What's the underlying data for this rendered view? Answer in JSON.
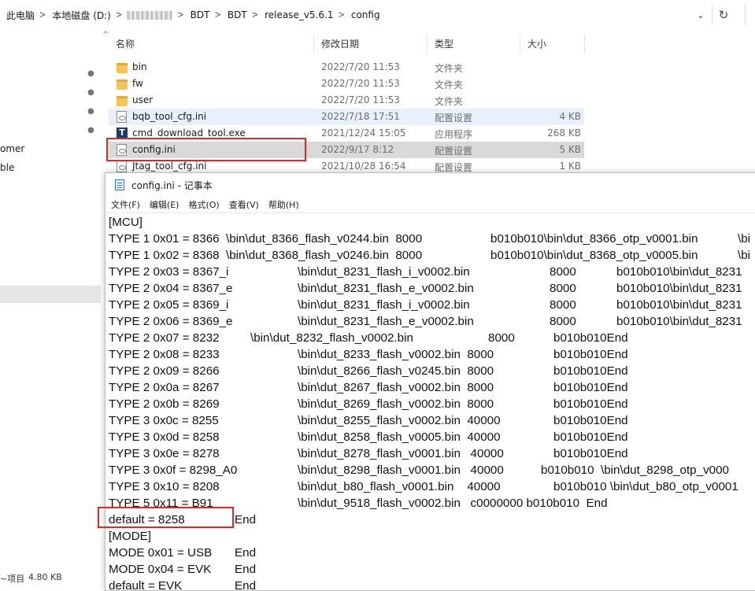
{
  "explorer": {
    "breadcrumbs": [
      "此电脑",
      "本地磁盘 (D:)",
      "BDT",
      "BDT",
      "release_v5.6.1",
      "config"
    ],
    "columns": {
      "name": "名称",
      "date": "修改日期",
      "type": "类型",
      "size": "大小"
    },
    "nav": {
      "item_1": "omer",
      "item_2": "ble"
    },
    "status": {
      "items_label": "~项目",
      "size": "4.80 KB"
    },
    "files": [
      {
        "name": "bin",
        "date": "2022/7/20 11:53",
        "type": "文件夹",
        "size": "",
        "icon": "folder-icon"
      },
      {
        "name": "fw",
        "date": "2022/7/20 11:53",
        "type": "文件夹",
        "size": "",
        "icon": "folder-icon"
      },
      {
        "name": "user",
        "date": "2022/7/20 11:53",
        "type": "文件夹",
        "size": "",
        "icon": "folder-icon"
      },
      {
        "name": "bqb_tool_cfg.ini",
        "date": "2022/7/18 17:51",
        "type": "配置设置",
        "size": "4 KB",
        "icon": "ini-file-icon"
      },
      {
        "name": "cmd_download_tool.exe",
        "date": "2021/12/24 15:05",
        "type": "应用程序",
        "size": "268 KB",
        "icon": "exe-icon"
      },
      {
        "name": "config.ini",
        "date": "2022/9/17 8:12",
        "type": "配置设置",
        "size": "5 KB",
        "icon": "ini-file-icon"
      },
      {
        "name": "Jtag_tool_cfg.ini",
        "date": "2021/10/28 16:54",
        "type": "配置设置",
        "size": "1 KB",
        "icon": "ini-file-icon"
      }
    ],
    "colors": {
      "highlight": "#e0262b",
      "selected_row": "#d9d9d9",
      "folder": "#f6c35b"
    }
  },
  "notepad": {
    "title": "config.ini - 记事本",
    "menu": [
      "文件(F)",
      "编辑(E)",
      "格式(O)",
      "查看(V)",
      "帮助(H)"
    ],
    "lines": [
      [
        "[MCU]"
      ],
      [
        "TYPE 1 0x01 = 8366  \\bin\\dut_8366_flash_v0244.bin  8000",
        "b010b010\\bin\\dut_8366_otp_v0001.bin",
        "\\bi"
      ],
      [
        "TYPE 1 0x02 = 8368  \\bin\\dut_8368_flash_v0246.bin  8000",
        "b010b010\\bin\\dut_8368_otp_v0005.bin",
        "\\bi"
      ],
      [
        "TYPE 2 0x03 = 8367_i",
        "\\bin\\dut_8231_flash_i_v0002.bin",
        "8000",
        "b010b010\\bin\\dut_8231"
      ],
      [
        "TYPE 2 0x04 = 8367_e",
        "\\bin\\dut_8231_flash_e_v0002.bin",
        "8000",
        "b010b010\\bin\\dut_8231"
      ],
      [
        "TYPE 2 0x05 = 8369_i",
        "\\bin\\dut_8231_flash_i_v0002.bin",
        "8000",
        "b010b010\\bin\\dut_8231"
      ],
      [
        "TYPE 2 0x06 = 8369_e",
        "\\bin\\dut_8231_flash_e_v0002.bin",
        "8000",
        "b010b010\\bin\\dut_8231"
      ],
      [
        "TYPE 2 0x07 = 8232",
        "\\bin\\dut_8232_flash_v0002.bin",
        "8000",
        "b010b010End"
      ],
      [
        "TYPE 2 0x08 = 8233",
        "\\bin\\dut_8233_flash_v0002.bin  8000",
        "b010b010End"
      ],
      [
        "TYPE 2 0x09 = 8266",
        "\\bin\\dut_8266_flash_v0245.bin  8000",
        "b010b010End"
      ],
      [
        "TYPE 2 0x0a = 8267",
        "\\bin\\dut_8267_flash_v0002.bin  8000",
        "b010b010End"
      ],
      [
        "TYPE 2 0x0b = 8269",
        "\\bin\\dut_8269_flash_v0002.bin  8000",
        "b010b010End"
      ],
      [
        "TYPE 3 0x0c = 8255",
        "\\bin\\dut_8255_flash_v0002.bin  40000",
        "b010b010End"
      ],
      [
        "TYPE 3 0x0d = 8258",
        "\\bin\\dut_8258_flash_v0005.bin  40000",
        "b010b010End"
      ],
      [
        "TYPE 3 0x0e = 8278",
        "\\bin\\dut_8278_flash_v0001.bin   40000",
        "b010b010End"
      ],
      [
        "TYPE 3 0x0f = 8298_A0",
        "\\bin\\dut_8298_flash_v0001.bin   40000",
        "b010b010  \\bin\\dut_8298_otp_v000"
      ],
      [
        "TYPE 3 0x10 = 8208",
        "\\bin\\dut_b80_flash_v0001.bin    40000",
        "b010b010 \\bin\\dut_b80_otp_v0001"
      ],
      [
        "TYPE 5 0x11 = B91",
        "\\bin\\dut_9518_flash_v0002.bin   c0000000 b010b010  End"
      ],
      [
        "default = 8258",
        "End"
      ],
      [
        "[MODE]"
      ],
      [
        "MODE 0x01 = USB",
        "End"
      ],
      [
        "MODE 0x04 = EVK",
        "End"
      ],
      [
        "default = EVK",
        "End"
      ]
    ]
  }
}
